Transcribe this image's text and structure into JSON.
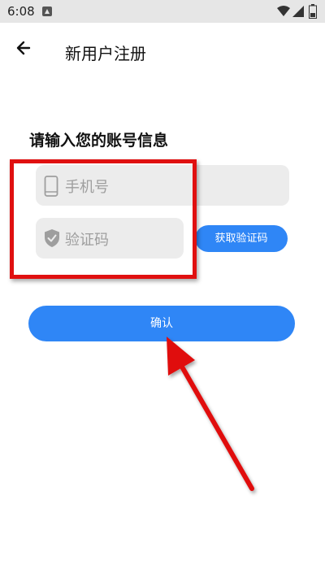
{
  "status_bar": {
    "time": "6:08",
    "icons": [
      "notification-icon",
      "wifi-icon",
      "signal-icon",
      "battery-icon"
    ]
  },
  "header": {
    "back_icon": "arrow-left-icon",
    "title": "新用户注册"
  },
  "form": {
    "heading": "请输入您的账号信息",
    "phone": {
      "icon": "phone-icon",
      "placeholder": "手机号",
      "value": ""
    },
    "code": {
      "icon": "shield-check-icon",
      "placeholder": "验证码",
      "value": ""
    },
    "get_code_label": "获取验证码",
    "confirm_label": "确认"
  },
  "colors": {
    "accent": "#2f86f6",
    "input_bg": "#ececec",
    "annotation": "#e01010",
    "status_bar_bg": "#e6e6e6"
  }
}
